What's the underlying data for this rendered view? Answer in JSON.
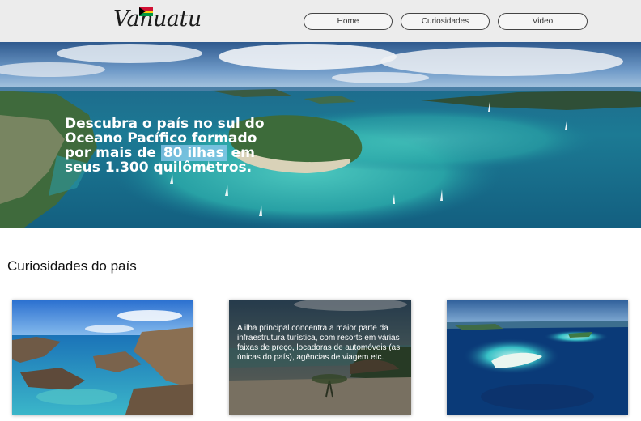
{
  "header": {
    "logo_text": "Vanuatu",
    "nav": [
      {
        "label": "Home"
      },
      {
        "label": "Curiosidades"
      },
      {
        "label": "Video"
      }
    ]
  },
  "hero": {
    "text_before": "Descubra o país no sul do Oceano Pacífico formado por mais de ",
    "highlight": "80 ilhas",
    "text_after": " em seus 1.300 quilômetros."
  },
  "curiosidades": {
    "title": "Curiosidades do país",
    "cards": [
      {
        "text": ""
      },
      {
        "text": "A ilha principal concentra a maior parte da infraestrutura turística, com resorts em várias faixas de preço, locadoras de automóveis (as únicas do país), agências de viagem etc."
      },
      {
        "text": ""
      }
    ]
  },
  "colors": {
    "flag": [
      "#d21034",
      "#009543",
      "#000000",
      "#fdce12"
    ],
    "highlight": "#96cdf5"
  },
  "icons": [
    "vanuatu-flag-icon"
  ]
}
